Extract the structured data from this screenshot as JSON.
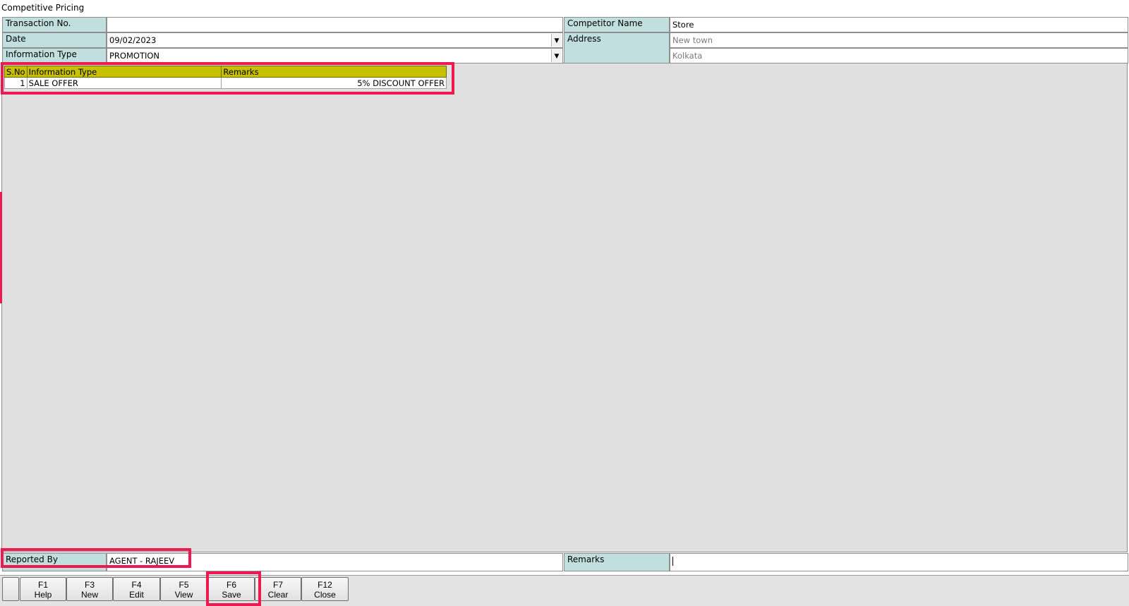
{
  "window": {
    "title": "Competitive Pricing"
  },
  "form": {
    "transaction_no": {
      "label": "Transaction No.",
      "value": ""
    },
    "date": {
      "label": "Date",
      "value": "09/02/2023"
    },
    "information_type": {
      "label": "Information Type",
      "value": "PROMOTION"
    },
    "competitor_name": {
      "label": "Competitor Name",
      "value": "Store"
    },
    "address": {
      "label": "Address",
      "line1": "New town",
      "line2": "Kolkata"
    }
  },
  "grid": {
    "columns": [
      "S.No",
      "Information Type",
      "Remarks"
    ],
    "rows": [
      {
        "sno": "1",
        "information_type": "SALE OFFER",
        "remarks": "5% DISCOUNT OFFER"
      }
    ]
  },
  "footer": {
    "reported_by": {
      "label": "Reported By",
      "value": "AGENT - RAJEEV"
    },
    "remarks": {
      "label": "Remarks",
      "value": ""
    }
  },
  "toolbar": {
    "buttons": [
      {
        "key": "F1",
        "label": "Help"
      },
      {
        "key": "F3",
        "label": "New"
      },
      {
        "key": "F4",
        "label": "Edit"
      },
      {
        "key": "F5",
        "label": "View"
      },
      {
        "key": "F6",
        "label": "Save"
      },
      {
        "key": "F7",
        "label": "Clear"
      },
      {
        "key": "F12",
        "label": "Close"
      }
    ]
  },
  "colors": {
    "label_bg": "#c1dfdf",
    "grid_header_bg": "#c6c000",
    "highlight": "#ee1a4f",
    "grid_area_bg": "#e0e0e0"
  }
}
